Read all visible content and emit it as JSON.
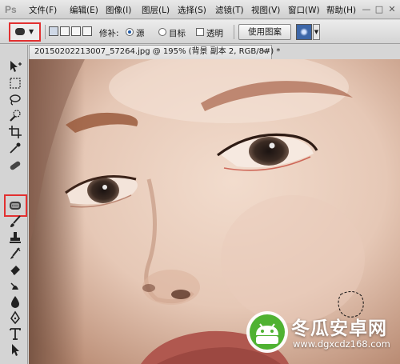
{
  "app": {
    "logo": "Ps"
  },
  "menu": {
    "items": [
      "文件(F)",
      "编辑(E)",
      "图像(I)",
      "图层(L)",
      "选择(S)",
      "滤镜(T)",
      "视图(V)",
      "窗口(W)",
      "帮助(H)"
    ]
  },
  "window_controls": [
    "—",
    "□",
    "✕"
  ],
  "options_bar": {
    "tool_preset_icon": "patch-tool-icon",
    "patch_label": "修补:",
    "source_label": "源",
    "destination_label": "目标",
    "transparent_label": "透明",
    "use_pattern_label": "使用图案",
    "source_selected": true,
    "destination_selected": false,
    "transparent_checked": false
  },
  "toolbar": {
    "tools": [
      "move-tool-icon",
      "marquee-tool-icon",
      "lasso-tool-icon",
      "quick-selection-tool-icon",
      "crop-tool-icon",
      "eyedropper-tool-icon",
      "patch-tool-icon",
      "brush-tool-icon",
      "clone-stamp-tool-icon",
      "history-brush-tool-icon",
      "eraser-tool-icon",
      "gradient-tool-icon",
      "blur-tool-icon",
      "dodge-tool-icon",
      "pen-tool-icon",
      "type-tool-icon",
      "path-selection-tool-icon",
      "rectangle-tool-icon",
      "hand-tool-icon"
    ],
    "selected_tool": "patch-tool-icon"
  },
  "document": {
    "tab_title": "20150202213007_57264.jpg @ 195% (背景 副本 2, RGB/8#) *",
    "close": "×"
  },
  "watermark": {
    "title": "冬瓜安卓网",
    "url": "www.dgxcdz168.com"
  },
  "colors": {
    "highlight": "#e23030",
    "selected_radio": "#1f5aa8",
    "skin": "#e8cdbd"
  }
}
